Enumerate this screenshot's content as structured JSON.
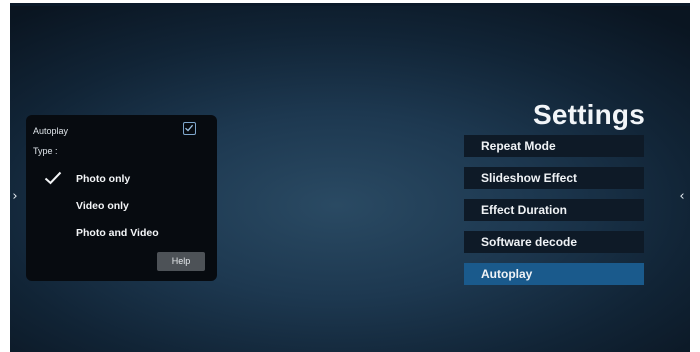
{
  "settings": {
    "title": "Settings",
    "menu": [
      {
        "label": "Repeat Mode",
        "selected": false
      },
      {
        "label": "Slideshow Effect",
        "selected": false
      },
      {
        "label": "Effect Duration",
        "selected": false
      },
      {
        "label": "Software decode",
        "selected": false
      },
      {
        "label": "Autoplay",
        "selected": true
      }
    ]
  },
  "popup": {
    "autoplay_label": "Autoplay",
    "autoplay_checked": true,
    "type_label": "Type :",
    "options": [
      {
        "label": "Photo only",
        "checked": true
      },
      {
        "label": "Video only",
        "checked": false
      },
      {
        "label": "Photo and Video",
        "checked": false
      }
    ],
    "help_label": "Help"
  },
  "nav": {
    "left_arrow": "›",
    "right_arrow": "‹"
  },
  "colors": {
    "selected_item": "#1a5a8c",
    "menu_item": "#0e1a27",
    "popup_bg": "#070b10",
    "help_button": "#4d5257",
    "checkbox_border": "#7fa7cc"
  },
  "icons": {
    "checkbox": "checked-box-icon",
    "option_check": "checkmark-icon"
  }
}
